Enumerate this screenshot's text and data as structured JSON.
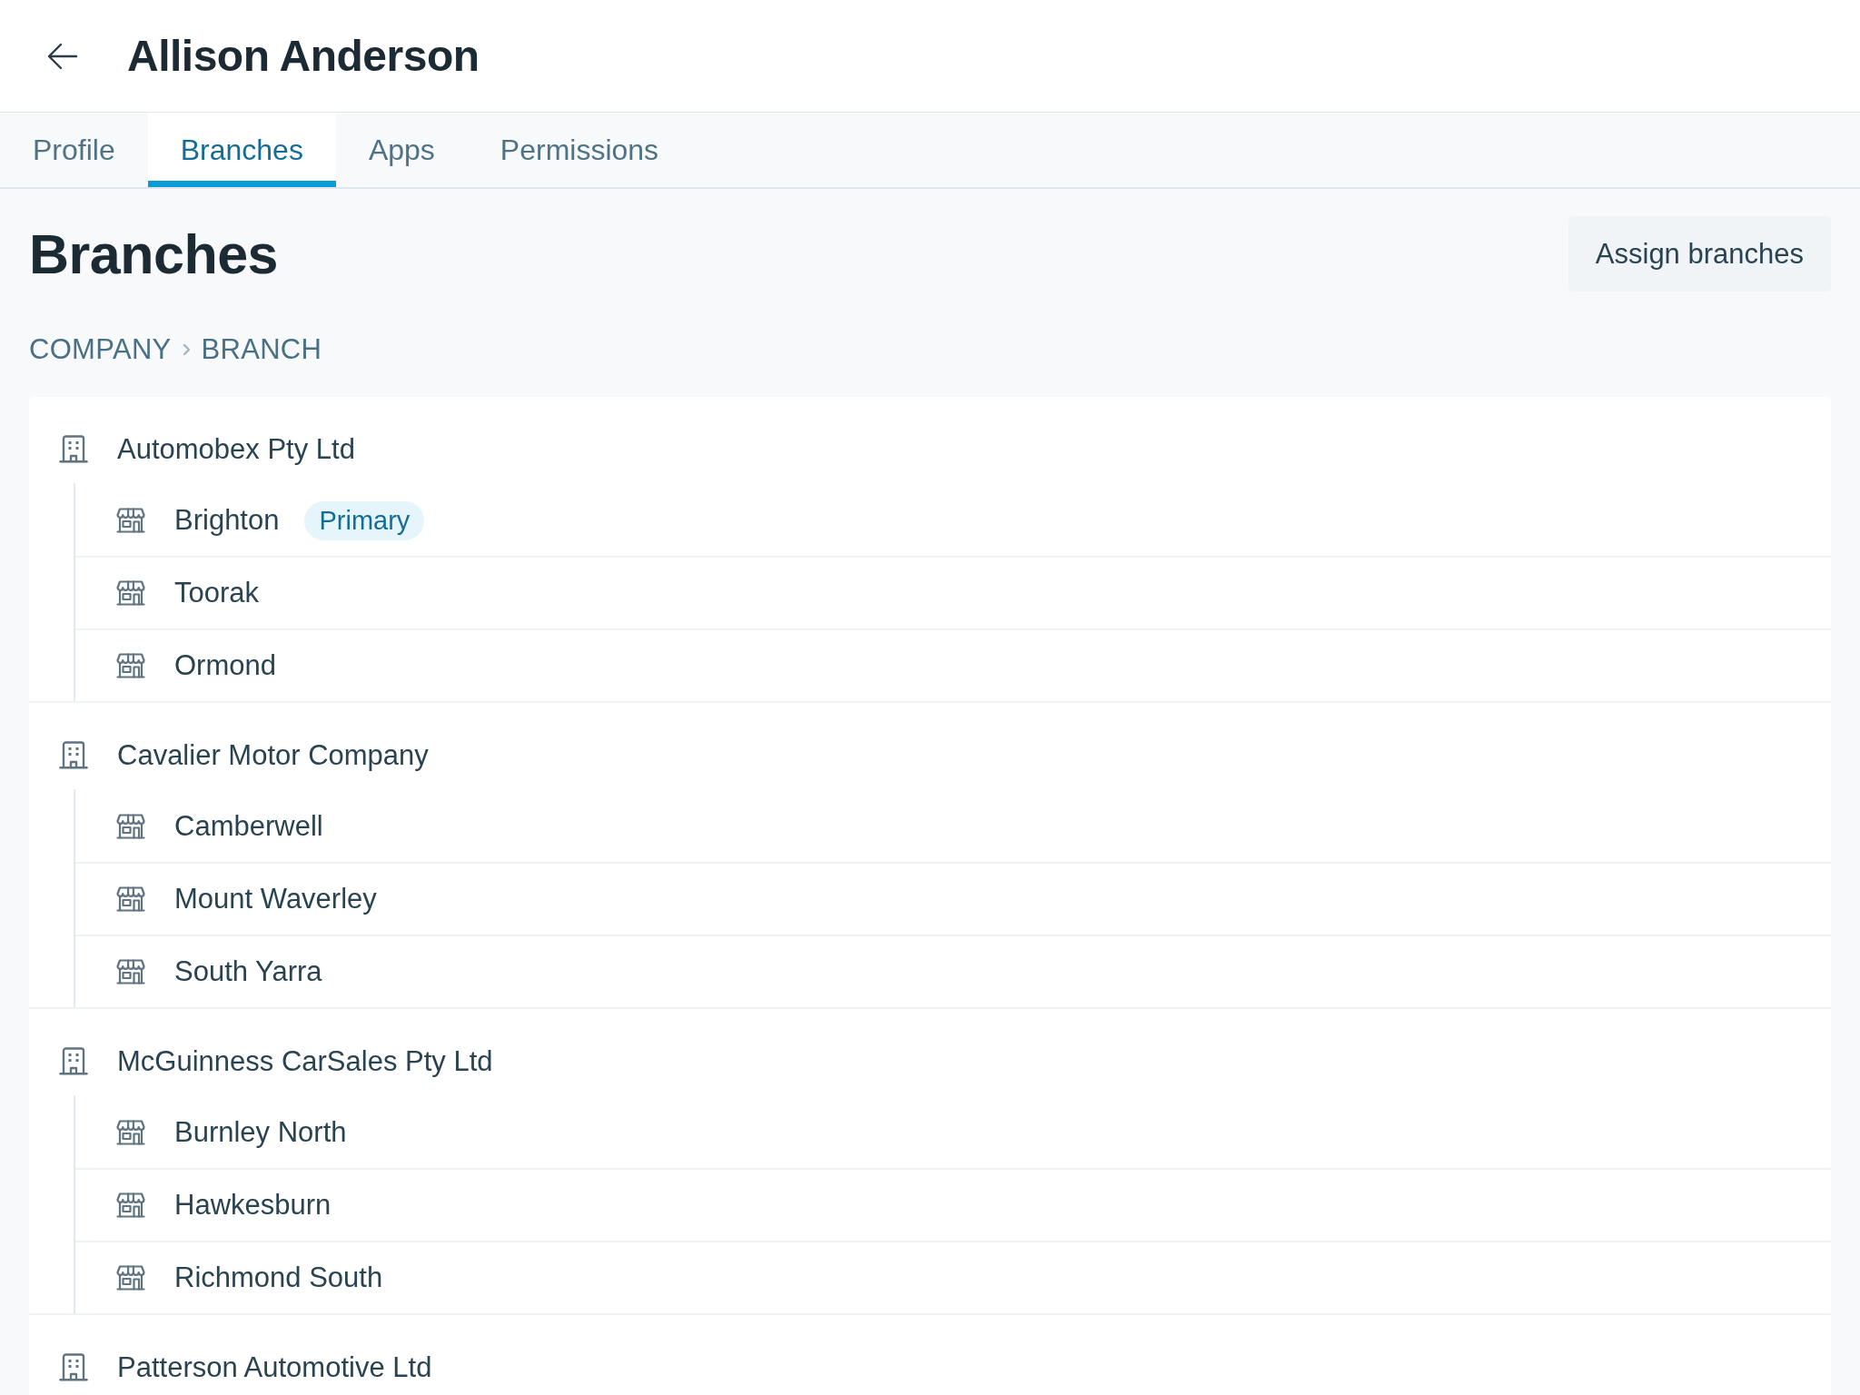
{
  "header": {
    "title": "Allison Anderson"
  },
  "tabs": [
    {
      "label": "Profile",
      "selected": false
    },
    {
      "label": "Branches",
      "selected": true
    },
    {
      "label": "Apps",
      "selected": false
    },
    {
      "label": "Permissions",
      "selected": false
    }
  ],
  "section": {
    "title": "Branches",
    "button": "Assign branches"
  },
  "breadcrumb": [
    "COMPANY",
    "BRANCH"
  ],
  "companies": [
    {
      "name": "Automobex Pty Ltd",
      "children": [
        {
          "name": "Brighton",
          "badge": "Primary"
        },
        {
          "name": "Toorak"
        },
        {
          "name": "Ormond"
        }
      ]
    },
    {
      "name": "Cavalier Motor Company",
      "children": [
        {
          "name": "Camberwell"
        },
        {
          "name": "Mount Waverley"
        },
        {
          "name": "South Yarra"
        }
      ]
    },
    {
      "name": "McGuinness CarSales Pty Ltd",
      "children": [
        {
          "name": "Burnley North"
        },
        {
          "name": "Hawkesburn"
        },
        {
          "name": "Richmond South"
        }
      ]
    },
    {
      "name": "Patterson Automotive Ltd"
    }
  ]
}
